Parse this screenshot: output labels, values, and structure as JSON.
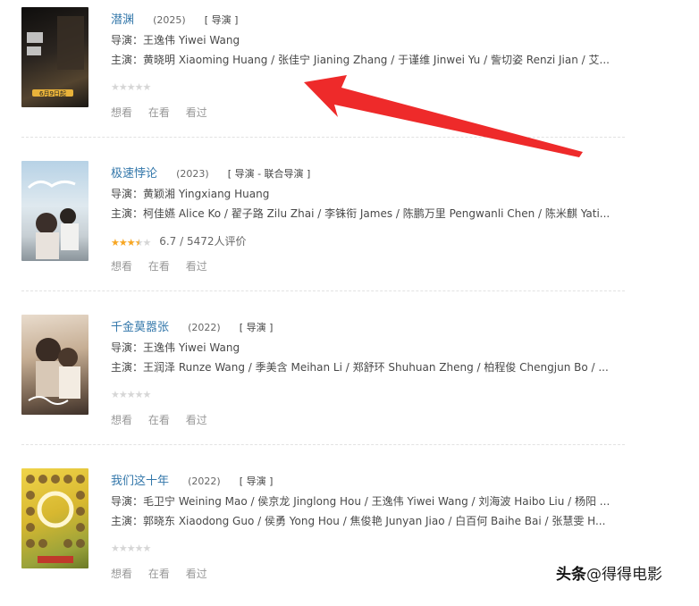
{
  "movies": [
    {
      "title": "潜渊",
      "year": "(2025)",
      "role": "[ 导演 ]",
      "director": "导演：王逸伟 Yiwei Wang",
      "cast": "主演：黄晓明 Xiaoming Huang / 张佳宁 Jianing Zhang / 于谨维 Jinwei Yu / 訾切姿 Renzi Jian / 艾...",
      "stars_filled": 0,
      "stars_display": "★★★★★",
      "rating_text": "",
      "actions": [
        "想看",
        "在看",
        "看过"
      ],
      "poster_colors": [
        "#1e1c1a",
        "#4a3b2a"
      ],
      "poster_text": "6月9日起"
    },
    {
      "title": "极速悖论",
      "year": "(2023)",
      "role": "[ 导演 - 联合导演 ]",
      "director": "导演：黄颖湘 Yingxiang Huang",
      "cast": "主演：柯佳嬿 Alice Ko / 翟子路 Zilu Zhai / 李铢衔 James / 陈鹏万里 Pengwanli Chen / 陈米麒 Yati...",
      "stars_filled": 3.5,
      "stars_display": "★★★★★",
      "rating_text": "6.7 / 5472人评价",
      "actions": [
        "想看",
        "在看",
        "看过"
      ],
      "poster_colors": [
        "#a9c7df",
        "#e6eef3"
      ],
      "poster_text": ""
    },
    {
      "title": "千金莫嚣张",
      "year": "(2022)",
      "role": "[ 导演 ]",
      "director": "导演：王逸伟 Yiwei Wang",
      "cast": "主演：王润泽 Runze Wang / 季美含 Meihan Li / 郑舒环 Shuhuan Zheng / 柏程俊 Chengjun Bo / ...",
      "stars_filled": 0,
      "stars_display": "★★★★★",
      "rating_text": "",
      "actions": [
        "想看",
        "在看",
        "看过"
      ],
      "poster_colors": [
        "#c9b29a",
        "#5a4a3c"
      ],
      "poster_text": ""
    },
    {
      "title": "我们这十年",
      "year": "(2022)",
      "role": "[ 导演 ]",
      "director": "导演：毛卫宁 Weining Mao / 侯京龙 Jinglong Hou / 王逸伟 Yiwei Wang / 刘海波 Haibo Liu / 杨阳 ...",
      "cast": "主演：郭晓东 Xiaodong Guo / 侯勇 Yong Hou / 焦俊艳 Junyan Jiao / 白百何 Baihe Bai / 张慧雯 H...",
      "stars_filled": 0,
      "stars_display": "★★★★★",
      "rating_text": "",
      "actions": [
        "想看",
        "在看",
        "看过"
      ],
      "poster_colors": [
        "#e4c53a",
        "#7a8f2a"
      ],
      "poster_text": ""
    }
  ],
  "watermark": {
    "prefix": "头条",
    "handle": "@得得电影"
  },
  "colors": {
    "link": "#3377aa",
    "annotation_arrow": "#ee2a2a",
    "star_on": "#f7a622",
    "star_off": "#d6d6d6"
  }
}
